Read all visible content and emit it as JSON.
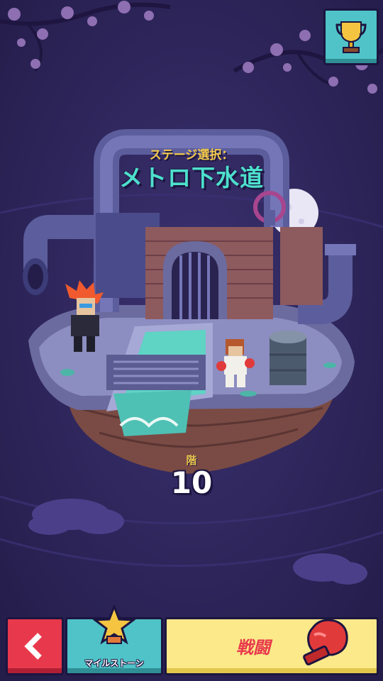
{
  "stage": {
    "caption": "ステージ選択：",
    "name": "メトロ下水道"
  },
  "floor": {
    "label": "階",
    "number": "10"
  },
  "buttons": {
    "milestone_label": "マイルストーン",
    "battle_label": "戦闘"
  },
  "icons": {
    "trophy": "trophy-icon",
    "back": "chevron-left-icon",
    "milestone": "star-icon",
    "battle": "boxing-glove-icon"
  },
  "colors": {
    "background": "#2e2658",
    "accent_teal": "#4fc3c8",
    "accent_red": "#e8394c",
    "accent_yellow": "#fbe98a",
    "caption_gold": "#f2c94c"
  }
}
